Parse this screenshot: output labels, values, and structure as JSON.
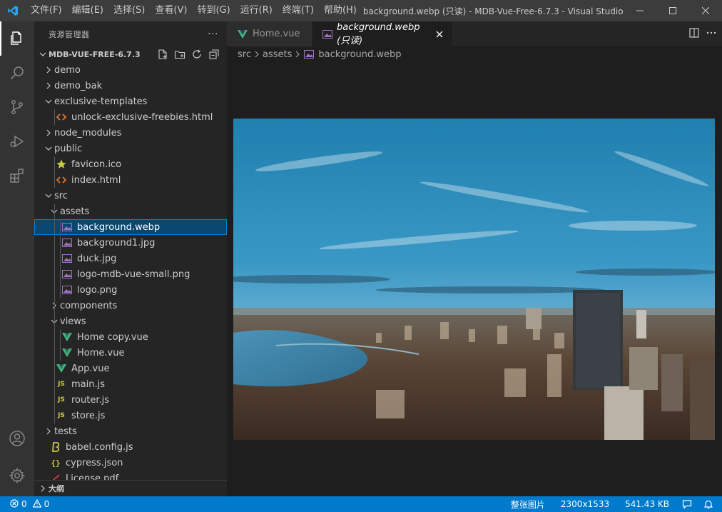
{
  "window": {
    "title": "background.webp (只读) - MDB-Vue-Free-6.7.3 - Visual Studio Code [...",
    "menu": [
      "文件(F)",
      "编辑(E)",
      "选择(S)",
      "查看(V)",
      "转到(G)",
      "运行(R)",
      "终端(T)",
      "帮助(H)"
    ]
  },
  "sidebar": {
    "title": "资源管理器",
    "more": "···",
    "project": "MDB-VUE-FREE-6.7.3",
    "outline": "大纲",
    "tree": [
      {
        "label": "demo",
        "depth": 0,
        "type": "folder",
        "open": false
      },
      {
        "label": "demo_bak",
        "depth": 0,
        "type": "folder",
        "open": false
      },
      {
        "label": "exclusive-templates",
        "depth": 0,
        "type": "folder",
        "open": true
      },
      {
        "label": "unlock-exclusive-freebies.html",
        "depth": 1,
        "type": "html"
      },
      {
        "label": "node_modules",
        "depth": 0,
        "type": "folder",
        "open": false
      },
      {
        "label": "public",
        "depth": 0,
        "type": "folder",
        "open": true
      },
      {
        "label": "favicon.ico",
        "depth": 1,
        "type": "ico"
      },
      {
        "label": "index.html",
        "depth": 1,
        "type": "html"
      },
      {
        "label": "src",
        "depth": 0,
        "type": "folder",
        "open": true
      },
      {
        "label": "assets",
        "depth": 1,
        "type": "folder",
        "open": true
      },
      {
        "label": "background.webp",
        "depth": 2,
        "type": "image",
        "selected": true
      },
      {
        "label": "background1.jpg",
        "depth": 2,
        "type": "image"
      },
      {
        "label": "duck.jpg",
        "depth": 2,
        "type": "image"
      },
      {
        "label": "logo-mdb-vue-small.png",
        "depth": 2,
        "type": "image"
      },
      {
        "label": "logo.png",
        "depth": 2,
        "type": "image"
      },
      {
        "label": "components",
        "depth": 1,
        "type": "folder",
        "open": false
      },
      {
        "label": "views",
        "depth": 1,
        "type": "folder",
        "open": true
      },
      {
        "label": "Home copy.vue",
        "depth": 2,
        "type": "vue"
      },
      {
        "label": "Home.vue",
        "depth": 2,
        "type": "vue"
      },
      {
        "label": "App.vue",
        "depth": 1,
        "type": "vue"
      },
      {
        "label": "main.js",
        "depth": 1,
        "type": "js"
      },
      {
        "label": "router.js",
        "depth": 1,
        "type": "js"
      },
      {
        "label": "store.js",
        "depth": 1,
        "type": "js"
      },
      {
        "label": "tests",
        "depth": 0,
        "type": "folder",
        "open": false
      },
      {
        "label": "babel.config.js",
        "depth": 0,
        "type": "babel"
      },
      {
        "label": "cypress.json",
        "depth": 0,
        "type": "json"
      },
      {
        "label": "License.pdf",
        "depth": 0,
        "type": "pdf"
      }
    ]
  },
  "editor": {
    "tabs": [
      {
        "label": "Home.vue",
        "active": false,
        "type": "vue"
      },
      {
        "label": "background.webp (只读)",
        "active": true,
        "type": "image"
      }
    ],
    "breadcrumb": [
      "src",
      "assets",
      "background.webp"
    ]
  },
  "statusbar": {
    "errors": "0",
    "warnings": "0",
    "image_mode": "整张图片",
    "dimensions": "2300x1533",
    "size": "541.43 KB"
  },
  "colors": {
    "statusbar": "#007acc",
    "vue": "#41b883",
    "js": "#cbcb41",
    "html": "#e37933",
    "image": "#a074c4",
    "selection": "#094771"
  }
}
